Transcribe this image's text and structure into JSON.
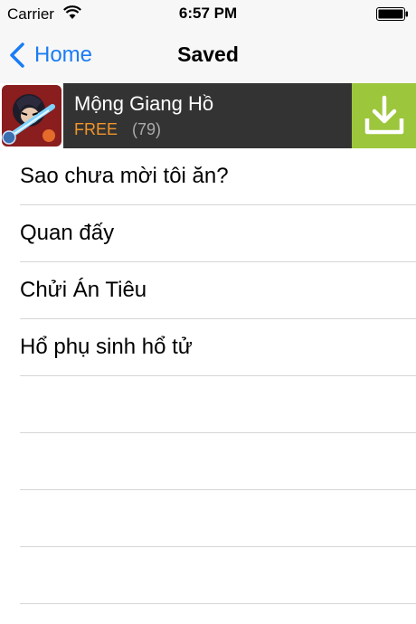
{
  "status_bar": {
    "carrier": "Carrier",
    "time": "6:57 PM",
    "icons": [
      "wifi-icon",
      "battery-icon"
    ]
  },
  "nav": {
    "back_label": "Home",
    "title": "Saved",
    "accent": "#1a7cf5"
  },
  "ad": {
    "title": "Mộng Giang Hồ",
    "price": "FREE",
    "rating_count": "(79)",
    "colors": {
      "background": "#333333",
      "price": "#f2952a",
      "download": "#9cc63b"
    },
    "icons": [
      "app-art-icon",
      "download-icon"
    ]
  },
  "list": {
    "items": [
      "Sao chưa mời tôi ăn?",
      "Quan đấy",
      "Chửi Án Tiêu",
      "Hổ phụ sinh hổ tử",
      "",
      "",
      "",
      ""
    ]
  }
}
